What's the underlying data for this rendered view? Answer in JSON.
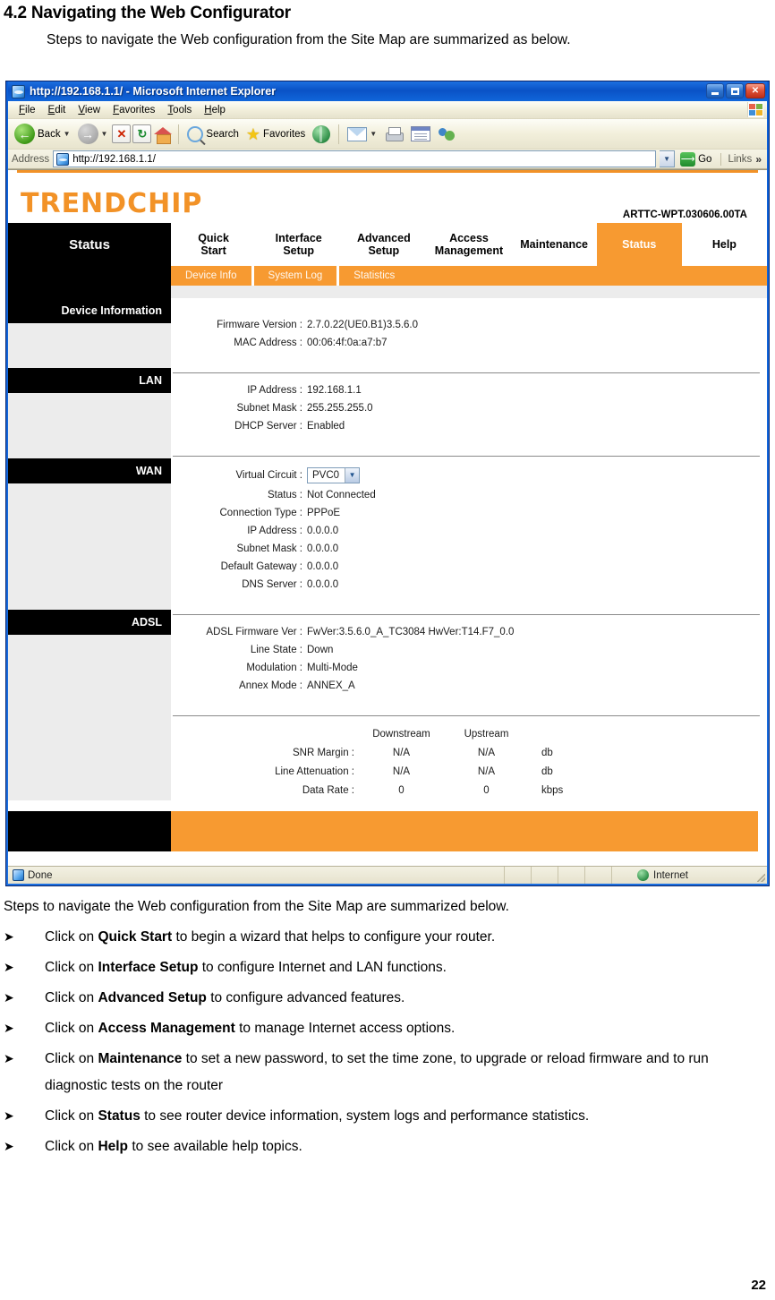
{
  "document": {
    "heading": "4.2 Navigating the Web Configurator",
    "intro": "Steps to navigate the Web configuration from the Site Map are summarized as below.",
    "lead_below": "Steps to navigate the Web configuration from the Site Map are summarized below.",
    "page_number": "22",
    "bullet_marker": "➤",
    "bullets": [
      {
        "prefix": "Click on ",
        "bold": "Quick Start",
        "suffix": " to begin a wizard that helps to configure your router."
      },
      {
        "prefix": "Click on ",
        "bold": "Interface Setup",
        "suffix": " to configure Internet and LAN functions."
      },
      {
        "prefix": "Click on ",
        "bold": "Advanced Setup",
        "suffix": " to configure advanced features."
      },
      {
        "prefix": "Click on ",
        "bold": "Access Management",
        "suffix": " to manage Internet access options."
      },
      {
        "prefix": "Click on ",
        "bold": "Maintenance",
        "suffix": " to set a new password, to set the time zone, to upgrade or reload firmware and to run diagnostic tests on the router"
      },
      {
        "prefix": "Click on ",
        "bold": "Status",
        "suffix": " to see router device information, system logs and performance statistics."
      },
      {
        "prefix": "Click on ",
        "bold": "Help",
        "suffix": " to see available help topics."
      }
    ]
  },
  "browser": {
    "title": "http://192.168.1.1/ - Microsoft Internet Explorer",
    "window_buttons": {
      "minimize": "Minimize",
      "maximize": "Maximize",
      "close": "Close"
    },
    "menu": [
      {
        "label": "File",
        "accel": "F",
        "rest": "ile"
      },
      {
        "label": "Edit",
        "accel": "E",
        "rest": "dit"
      },
      {
        "label": "View",
        "accel": "V",
        "rest": "iew"
      },
      {
        "label": "Favorites",
        "accel": "F",
        "rest": "avorites"
      },
      {
        "label": "Tools",
        "accel": "T",
        "rest": "ools"
      },
      {
        "label": "Help",
        "accel": "H",
        "rest": "elp"
      }
    ],
    "toolbar": {
      "back": "Back",
      "search": "Search",
      "favorites": "Favorites"
    },
    "address": {
      "label": "Address",
      "value": "http://192.168.1.1/",
      "placeholder": "http://192.168.1.1/",
      "go": "Go",
      "links": "Links",
      "links_chevron": "»"
    },
    "status": {
      "text": "Done",
      "zone": "Internet"
    }
  },
  "router": {
    "brand": "TRENDCHIP",
    "firmware_tag": "ARTTC-WPT.030606.00TA",
    "page_title": "Status",
    "nav_tabs": [
      {
        "line1": "Quick",
        "line2": "Start",
        "active": false
      },
      {
        "line1": "Interface",
        "line2": "Setup",
        "active": false
      },
      {
        "line1": "Advanced",
        "line2": "Setup",
        "active": false
      },
      {
        "line1": "Access",
        "line2": "Management",
        "active": false
      },
      {
        "line1": "Maintenance",
        "line2": "",
        "active": false
      },
      {
        "line1": "Status",
        "line2": "",
        "active": true
      },
      {
        "line1": "Help",
        "line2": "",
        "active": false
      }
    ],
    "sub_tabs": [
      {
        "label": "Device Info"
      },
      {
        "label": "System Log"
      },
      {
        "label": "Statistics"
      }
    ],
    "sections": {
      "device_information": {
        "title": "Device Information",
        "rows": [
          {
            "key": "Firmware Version :",
            "value": "2.7.0.22(UE0.B1)3.5.6.0"
          },
          {
            "key": "MAC Address :",
            "value": "00:06:4f:0a:a7:b7"
          }
        ]
      },
      "lan": {
        "title": "LAN",
        "rows": [
          {
            "key": "IP Address :",
            "value": "192.168.1.1"
          },
          {
            "key": "Subnet Mask :",
            "value": "255.255.255.0"
          },
          {
            "key": "DHCP Server :",
            "value": "Enabled"
          }
        ]
      },
      "wan": {
        "title": "WAN",
        "virtual_circuit": {
          "key": "Virtual Circuit :",
          "value": "PVC0",
          "options": [
            "PVC0"
          ]
        },
        "rows": [
          {
            "key": "Status :",
            "value": "Not Connected"
          },
          {
            "key": "Connection Type :",
            "value": "PPPoE"
          },
          {
            "key": "IP Address :",
            "value": "0.0.0.0"
          },
          {
            "key": "Subnet Mask :",
            "value": "0.0.0.0"
          },
          {
            "key": "Default Gateway :",
            "value": "0.0.0.0"
          },
          {
            "key": "DNS Server :",
            "value": "0.0.0.0"
          }
        ]
      },
      "adsl": {
        "title": "ADSL",
        "rows": [
          {
            "key": "ADSL Firmware Ver :",
            "value": "FwVer:3.5.6.0_A_TC3084 HwVer:T14.F7_0.0"
          },
          {
            "key": "Line State :",
            "value": "Down"
          },
          {
            "key": "Modulation :",
            "value": "Multi-Mode"
          },
          {
            "key": "Annex Mode :",
            "value": "ANNEX_A"
          }
        ],
        "stats": {
          "headers": [
            "",
            "Downstream",
            "Upstream",
            ""
          ],
          "rows": [
            {
              "key": "SNR Margin :",
              "down": "N/A",
              "up": "N/A",
              "unit": "db"
            },
            {
              "key": "Line Attenuation :",
              "down": "N/A",
              "up": "N/A",
              "unit": "db"
            },
            {
              "key": "Data Rate :",
              "down": "0",
              "up": "0",
              "unit": "kbps"
            }
          ]
        }
      }
    },
    "colors": {
      "accent": "#F79A31",
      "brand": "#F29227",
      "black": "#000000",
      "panel": "#ececec"
    }
  }
}
